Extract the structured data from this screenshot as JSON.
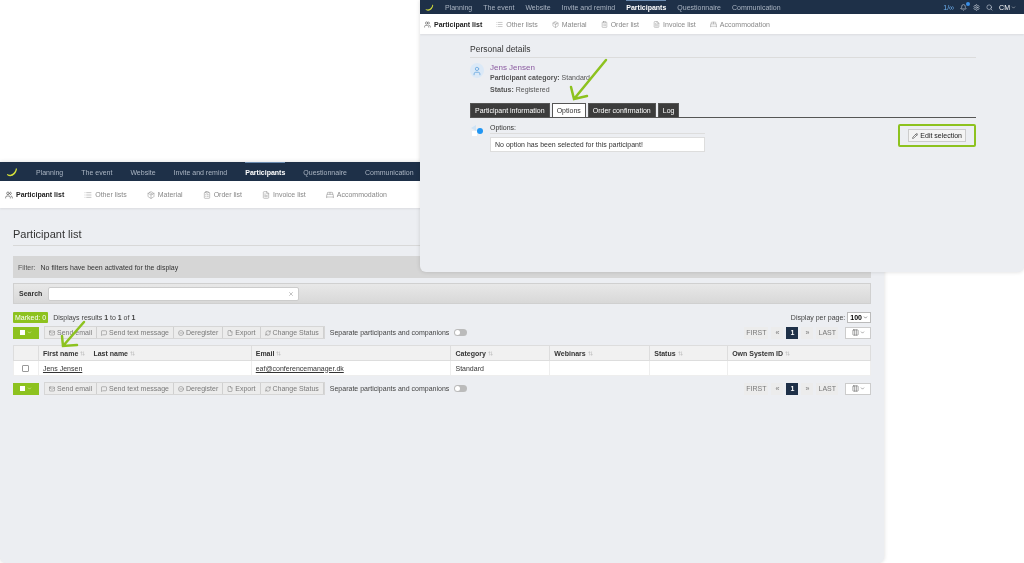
{
  "participant_list_window": {
    "nav": [
      {
        "label": "Planning",
        "selected": false
      },
      {
        "label": "The event",
        "selected": false
      },
      {
        "label": "Website",
        "selected": false
      },
      {
        "label": "Invite and remind",
        "selected": false
      },
      {
        "label": "Participants",
        "selected": true
      },
      {
        "label": "Questionnaire",
        "selected": false
      },
      {
        "label": "Communication",
        "selected": false
      }
    ],
    "subnav": [
      {
        "label": "Participant list",
        "kind": "users",
        "selected": true
      },
      {
        "label": "Other lists",
        "kind": "list",
        "selected": false
      },
      {
        "label": "Material",
        "kind": "material",
        "selected": false
      },
      {
        "label": "Order list",
        "kind": "order",
        "selected": false
      },
      {
        "label": "Invoice list",
        "kind": "invoice",
        "selected": false
      },
      {
        "label": "Accommodation",
        "kind": "bed",
        "selected": false
      }
    ],
    "title": "Participant list",
    "filter": {
      "label": "Filter:",
      "text": "No filters have been activated for the display"
    },
    "search": {
      "label": "Search"
    },
    "marked": {
      "label": "Marked:",
      "count": "0"
    },
    "results": "Displays results **1** to **1** of **1**",
    "display_per_page": {
      "label": "Display per page:",
      "value": "100"
    },
    "toolbars": [
      {
        "actions": [
          {
            "label": "Send email",
            "kind": "mail",
            "disabled": true
          },
          {
            "label": "Send text message",
            "kind": "message",
            "disabled": true
          },
          {
            "label": "Deregister",
            "kind": "minus",
            "disabled": true
          },
          {
            "label": "Export",
            "kind": "file",
            "disabled": true
          },
          {
            "label": "Change Status",
            "kind": "refresh",
            "disabled": true
          }
        ],
        "toggle": {
          "label": "Separate participants and companions",
          "on": false
        },
        "pagination": {
          "first": "FIRST",
          "prev": "«",
          "pages": [
            {
              "label": "1",
              "selected": true
            }
          ],
          "next": "»",
          "last": "LAST"
        }
      },
      {
        "actions": [
          {
            "label": "Send email",
            "kind": "mail",
            "disabled": true
          },
          {
            "label": "Send text message",
            "kind": "message",
            "disabled": true
          },
          {
            "label": "Deregister",
            "kind": "minus",
            "disabled": true
          },
          {
            "label": "Export",
            "kind": "file",
            "disabled": true
          },
          {
            "label": "Change Status",
            "kind": "refresh",
            "disabled": true
          }
        ],
        "toggle": {
          "label": "Separate participants and companions",
          "on": false
        },
        "pagination": {
          "first": "FIRST",
          "prev": "«",
          "pages": [
            {
              "label": "1",
              "selected": true
            }
          ],
          "next": "»",
          "last": "LAST"
        }
      }
    ],
    "table": {
      "columns": [
        {
          "labels": [
            "First name",
            "Last name"
          ]
        },
        {
          "labels": [
            "Email"
          ]
        },
        {
          "labels": [
            "Category"
          ]
        },
        {
          "labels": [
            "Webinars"
          ]
        },
        {
          "labels": [
            "Status"
          ]
        },
        {
          "labels": [
            "Own System ID"
          ]
        }
      ],
      "rows": [
        {
          "checked": false,
          "cells": [
            "Jens Jensen",
            "eaf@conferencemanager.dk",
            "Standard",
            "",
            "",
            ""
          ]
        }
      ]
    }
  },
  "details_window": {
    "nav": [
      {
        "label": "Planning",
        "selected": false
      },
      {
        "label": "The event",
        "selected": false
      },
      {
        "label": "Website",
        "selected": false
      },
      {
        "label": "Invite and remind",
        "selected": false
      },
      {
        "label": "Participants",
        "selected": true
      },
      {
        "label": "Questionnaire",
        "selected": false
      },
      {
        "label": "Communication",
        "selected": false
      }
    ],
    "counter": "1/∞",
    "user": "CM",
    "subnav": [
      {
        "label": "Participant list",
        "kind": "users",
        "selected": true
      },
      {
        "label": "Other lists",
        "kind": "list",
        "selected": false
      },
      {
        "label": "Material",
        "kind": "material",
        "selected": false
      },
      {
        "label": "Order list",
        "kind": "order",
        "selected": false
      },
      {
        "label": "Invoice list",
        "kind": "invoice",
        "selected": false
      },
      {
        "label": "Accommodation",
        "kind": "bed",
        "selected": false
      }
    ],
    "title": "Personal details",
    "person": {
      "name": "Jens Jensen",
      "category_label": "Participant category:",
      "category": "Standard",
      "status_label": "Status:",
      "status": "Registered"
    },
    "tabs": [
      {
        "label": "Participant information",
        "selected": false
      },
      {
        "label": "Options",
        "selected": true
      },
      {
        "label": "Order confirmation",
        "selected": false
      },
      {
        "label": "Log",
        "selected": false
      }
    ],
    "options": {
      "heading": "Options:",
      "message": "No option has been selected for this participant!",
      "button": "Edit selection"
    }
  }
}
